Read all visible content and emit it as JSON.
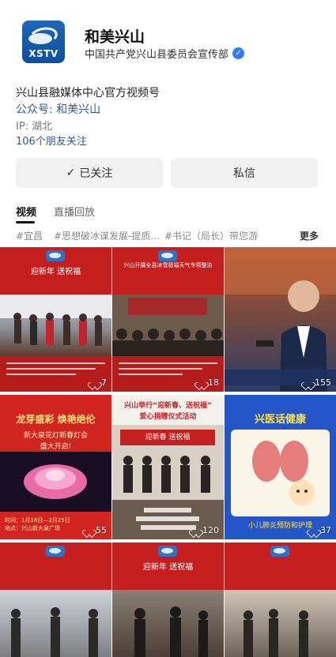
{
  "account": {
    "name": "和美兴山",
    "org": "中国共产党兴山县委员会宣传部",
    "logo_text": "XSTV",
    "verified_icon": "verified-badge-icon"
  },
  "profile": {
    "bio": "兴山县融媒体中心官方视频号",
    "official_account": "公众号: 和美兴山",
    "ip": "IP: 湖北",
    "friends": "106个朋友关注"
  },
  "actions": {
    "follow_label": "已关注",
    "follow_icon": "checkmark-icon",
    "message_label": "私信"
  },
  "tabs": [
    {
      "label": "视频",
      "active": true
    },
    {
      "label": "直播回放",
      "active": false
    }
  ],
  "tags": [
    "#宜昌",
    "#思想破冰谋发展-提质...",
    "#书记（局长）带您游"
  ],
  "more_label": "更多",
  "videos": [
    {
      "title": "迎新年  送祝福",
      "likes": "7"
    },
    {
      "title": "兴山开展全县冰雪极端天气专项整治",
      "likes": "18"
    },
    {
      "title": "",
      "likes": "155"
    },
    {
      "title": "龙芽盛彩  焕艳绝伦",
      "subtitle": "新大泉花灯新春灯会",
      "subtitle2": "盛大开启!",
      "caption": "时间：1月16日—2月25日\n地点：兴山新大泉广场",
      "likes": "55"
    },
    {
      "title": "兴山举行“迎新春、送祝福”",
      "subtitle": "爱心捐赠仪式活动",
      "banner": "迎新春 送祝福",
      "likes": "120"
    },
    {
      "title": "兴医话健康",
      "caption": "小儿肺炎预防和护理",
      "likes": "37"
    },
    {
      "title": "",
      "likes": ""
    },
    {
      "title": "迎新年  送祝福",
      "likes": ""
    },
    {
      "title": "",
      "likes": ""
    }
  ]
}
